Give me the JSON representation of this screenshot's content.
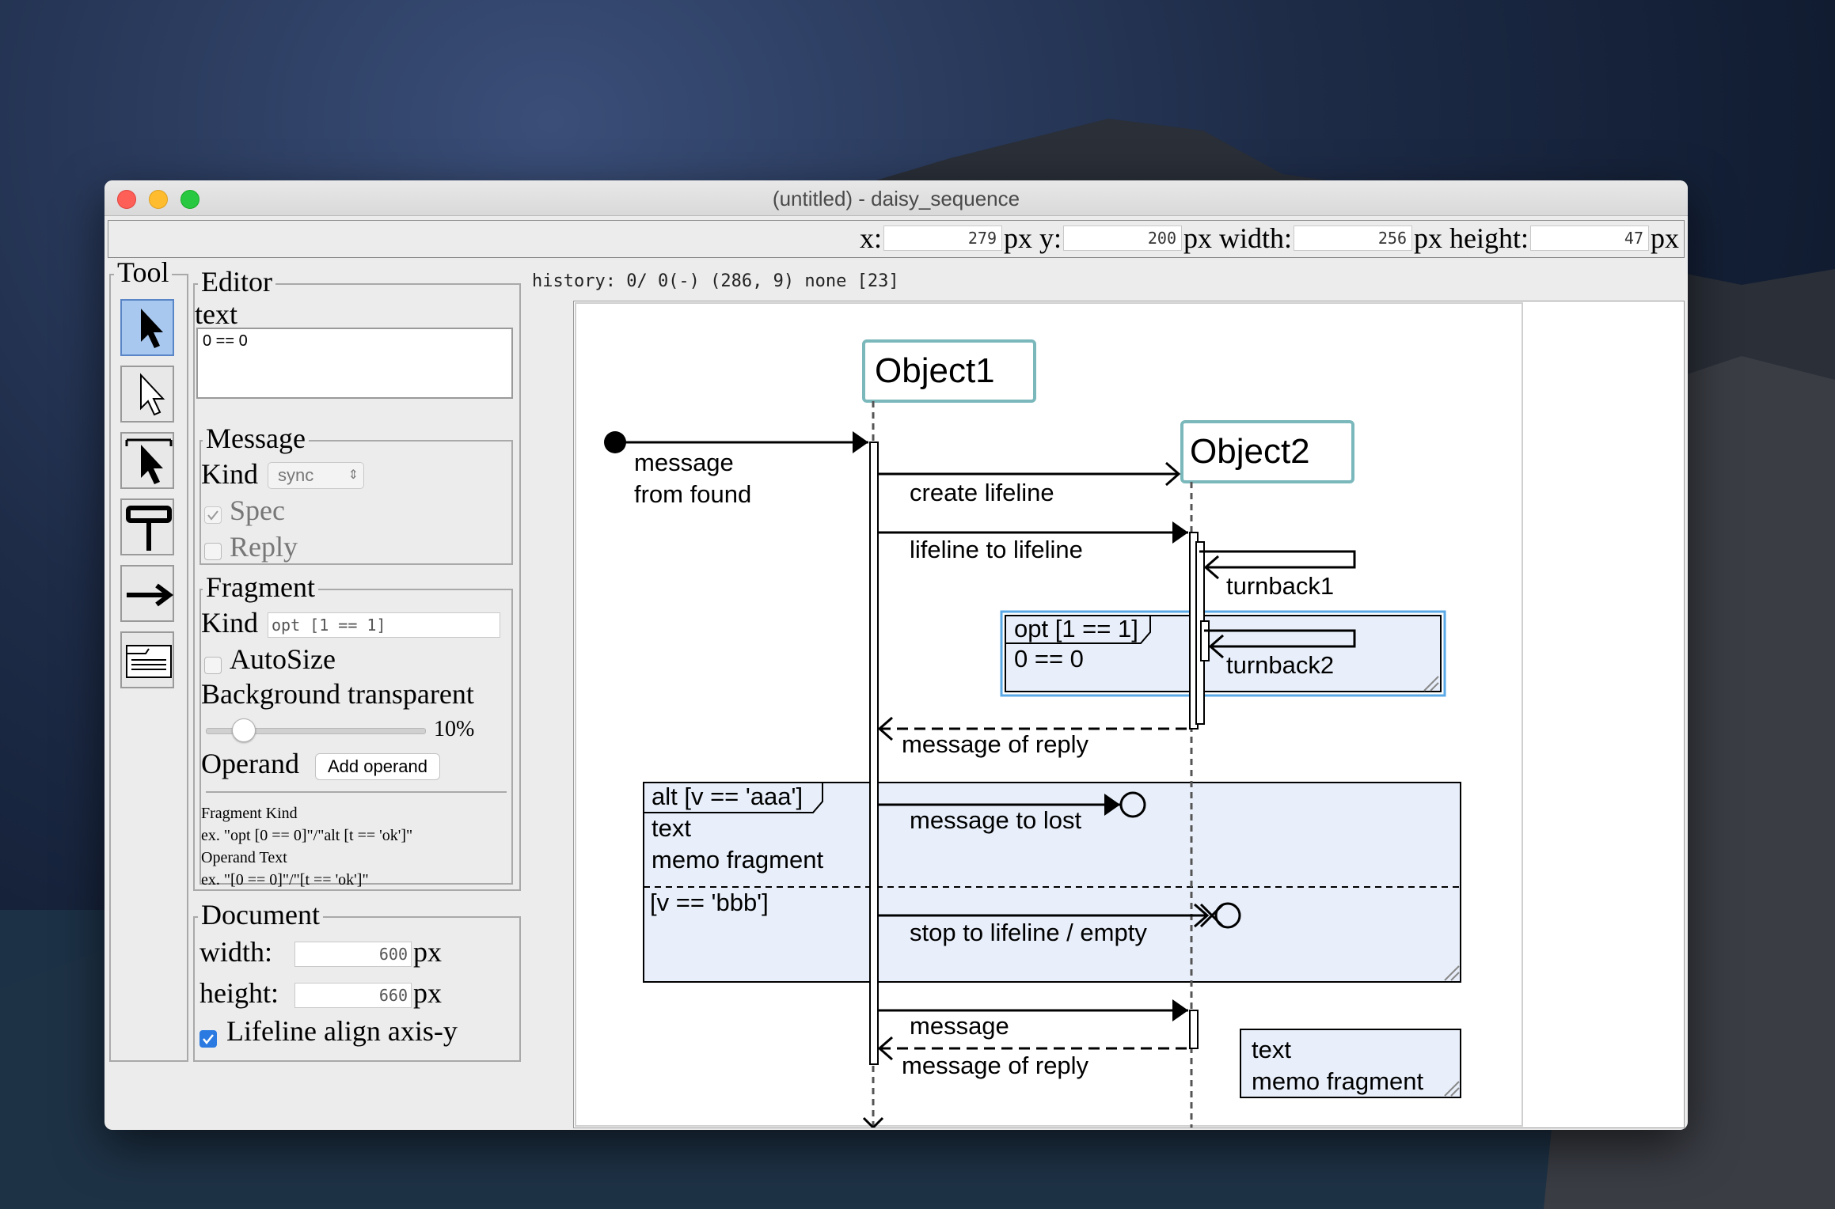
{
  "window": {
    "title": "(untitled) - daisy_sequence"
  },
  "coords": {
    "x_label": "x:",
    "x_value": "279",
    "x_unit": "px y:",
    "y_value": "200",
    "y_unit": "px width:",
    "width_value": "256",
    "width_unit": "px height:",
    "height_value": "47",
    "height_unit": "px"
  },
  "tool": {
    "legend": "Tool",
    "items": [
      "pointer-tool",
      "hollow-pointer-tool",
      "lifeline-pointer-tool",
      "lifeline-tool",
      "message-tool",
      "fragment-tool"
    ]
  },
  "editor": {
    "legend": "Editor",
    "text_label": "text",
    "text_value": "0 == 0",
    "message": {
      "legend": "Message",
      "kind_label": "Kind",
      "kind_value": "sync",
      "spec_label": "Spec",
      "spec_checked": true,
      "reply_label": "Reply",
      "reply_checked": false
    },
    "fragment": {
      "legend": "Fragment",
      "kind_label": "Kind",
      "kind_value": "opt [1 == 1]",
      "autosize_label": "AutoSize",
      "bg_label": "Background transparent",
      "bg_value": "10%",
      "bg_fraction": 0.1,
      "operand_label": "Operand",
      "add_operand": "Add operand",
      "help": [
        "Fragment Kind",
        "ex. \"opt [0 == 0]\"/\"alt [t == 'ok']\"",
        "Operand Text",
        "ex. \"[0 == 0]\"/\"[t == 'ok']\""
      ]
    }
  },
  "document": {
    "legend": "Document",
    "width_label": "width:",
    "width_value": "600",
    "width_unit": "px",
    "height_label": "height:",
    "height_value": "660",
    "height_unit": "px",
    "lifeline_label": "Lifeline align axis-y",
    "lifeline_checked": true
  },
  "history": "history: 0/ 0(-) (286, 9) none [23]",
  "diagram": {
    "object1": "Object1",
    "object2": "Object2",
    "found_msg_1": "message",
    "found_msg_2": "from found",
    "create": "create lifeline",
    "l2l": "lifeline to lifeline",
    "turnback1": "turnback1",
    "turnback2": "turnback2",
    "opt_kind": "opt [1 == 1]",
    "opt_text": "0 == 0",
    "reply1": "message of reply",
    "alt_kind": "alt [v == 'aaa']",
    "alt_text1": "text",
    "alt_text2": "memo fragment",
    "lost": "message to lost",
    "operand2": "[v == 'bbb']",
    "stop": "stop to lifeline / empty",
    "msg": "message",
    "reply2": "message of reply",
    "memo1": "text",
    "memo2": "memo fragment"
  },
  "colors": {
    "lifeline_box": "#7ab8bc",
    "fragment_fill": "#e8effa",
    "selection": "#5aa8e6"
  }
}
